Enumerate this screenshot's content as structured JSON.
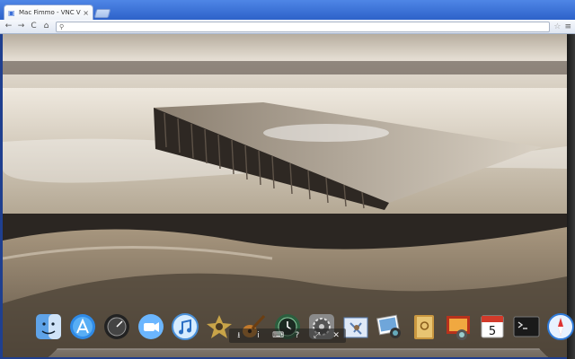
{
  "browser": {
    "tab_title": "Mac Fimmo - VNC Viewer",
    "tab_close": "×",
    "address_value": "",
    "nav": {
      "back": "←",
      "forward": "→",
      "reload": "C",
      "home": "⌂"
    },
    "bookmark_star": "☆",
    "wrench": "≡"
  },
  "dock": {
    "items": [
      {
        "icon": "finder-icon"
      },
      {
        "icon": "app-store-icon"
      },
      {
        "icon": "dashboard-icon"
      },
      {
        "icon": "facetime-icon"
      },
      {
        "icon": "itunes-icon"
      },
      {
        "icon": "imovie-icon"
      },
      {
        "icon": "garageband-icon"
      },
      {
        "icon": "time-machine-icon"
      },
      {
        "icon": "system-preferences-icon"
      },
      {
        "icon": "mail-icon"
      },
      {
        "icon": "iphoto-icon"
      },
      {
        "icon": "contacts-icon"
      },
      {
        "icon": "photo-booth-icon"
      },
      {
        "icon": "calendar-icon",
        "label": "5"
      },
      {
        "icon": "terminal-icon"
      },
      {
        "icon": "safari-icon"
      }
    ]
  },
  "vnc_controls": {
    "items": [
      "⭳",
      "i",
      "⌨",
      "?",
      "⤢",
      "✕"
    ]
  },
  "colors": {
    "chrome_frame": "#2d62c9",
    "photo_sepia": "#9a8c7a"
  }
}
